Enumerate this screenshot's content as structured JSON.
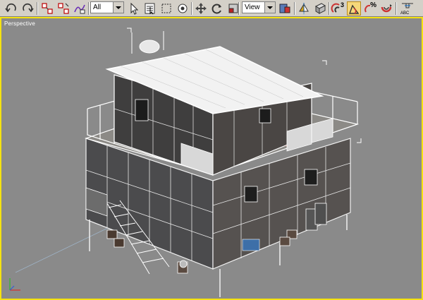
{
  "toolbar": {
    "buttons": {
      "undo": "undo-icon",
      "redo": "redo-icon",
      "select_and_link": "link-icon",
      "unlink_selection": "unlink-icon",
      "bind_to_space_warp": "bind-icon",
      "select_object": "select-arrow-icon",
      "select_by_name": "list-icon",
      "rectangular_selection": "rect-select-icon",
      "window_crossing": "crossing-icon",
      "select_and_move": "move-icon",
      "select_and_rotate": "rotate-icon",
      "select_and_scale": "scale-icon",
      "use_pivot_center": "pivot-icon",
      "mirror": "mirror-icon",
      "align": "align-icon",
      "snaps_toggle": "snap-3-icon",
      "angle_snap": "angle-snap-icon",
      "percent_snap": "percent-snap-icon",
      "spinner_snap": "spinner-snap-icon",
      "named_selection": "abc-icon"
    },
    "selection_filter": {
      "value": "All"
    },
    "reference_coord": {
      "value": "View"
    },
    "snap_number": "3",
    "percent_label": "%",
    "abc_label": "ABC"
  },
  "viewport": {
    "label": "Perspective",
    "border_color": "#f5e20f",
    "background_color": "#8a8a8a",
    "active_button_color": "#f6d77a"
  }
}
